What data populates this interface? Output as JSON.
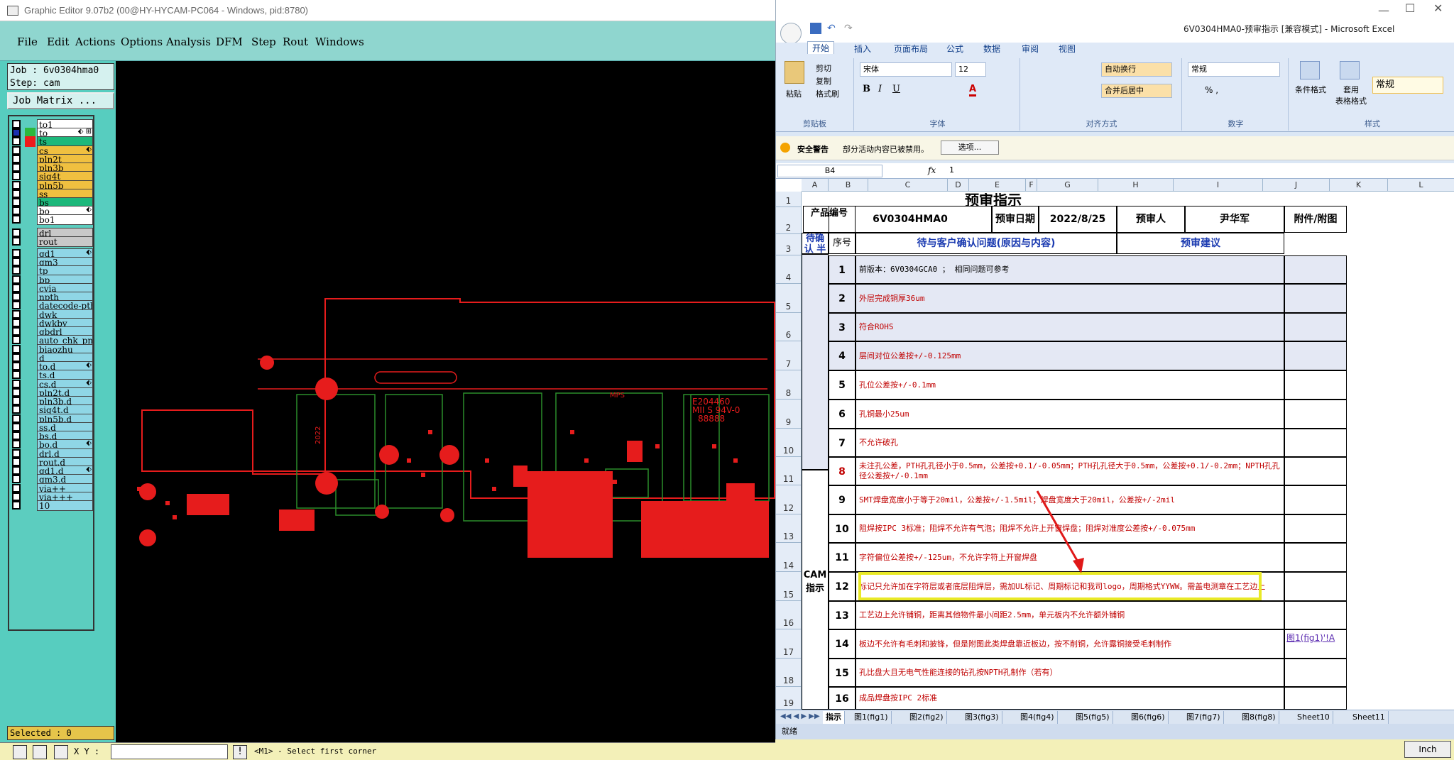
{
  "ge": {
    "title": "Graphic Editor 9.07b2 (00@HY-HYCAM-PC064 - Windows, pid:8780)",
    "menu": [
      "File",
      "Edit",
      "Actions",
      "Options",
      "Analysis",
      "DFM",
      "Step",
      "Rout",
      "Windows"
    ],
    "job": "Job : 6v0304hma0",
    "step": "Step: cam",
    "job_matrix": "Job Matrix ...",
    "layers": [
      {
        "name": "to1",
        "color": "#ffffff",
        "mark": "",
        "sel": "off"
      },
      {
        "name": "to",
        "color": "#ffffff",
        "mark": "⬖ ⊞",
        "sel": "on",
        "sw": "#2db83d"
      },
      {
        "name": "ts",
        "color": "#1db87b",
        "mark": "",
        "sel": "off",
        "sw": "#ee1c1c"
      },
      {
        "name": "cs",
        "color": "#f0c040",
        "mark": "⬖",
        "sel": "off"
      },
      {
        "name": "pln2t",
        "color": "#f0c040",
        "mark": "",
        "sel": "off"
      },
      {
        "name": "pln3b",
        "color": "#f0c040",
        "mark": "",
        "sel": "off"
      },
      {
        "name": "sig4t",
        "color": "#f0c040",
        "mark": "",
        "sel": "off"
      },
      {
        "name": "pln5b",
        "color": "#f0c040",
        "mark": "",
        "sel": "off"
      },
      {
        "name": "ss",
        "color": "#f0c040",
        "mark": "",
        "sel": "off"
      },
      {
        "name": "bs",
        "color": "#1db87b",
        "mark": "",
        "sel": "off"
      },
      {
        "name": "bo",
        "color": "#ffffff",
        "mark": "⬖",
        "sel": "off"
      },
      {
        "name": "bo1",
        "color": "#ffffff",
        "mark": "",
        "sel": "off"
      },
      {
        "name": "drl",
        "color": "#c8c8c8",
        "mark": "",
        "sel": "off"
      },
      {
        "name": "rout",
        "color": "#c8c8c8",
        "mark": "",
        "sel": "off"
      },
      {
        "name": "gd1",
        "color": "#8fd6e6",
        "mark": "⬖",
        "sel": "off"
      },
      {
        "name": "gm3",
        "color": "#8fd6e6",
        "mark": "",
        "sel": "off"
      },
      {
        "name": "tp",
        "color": "#8fd6e6",
        "mark": "",
        "sel": "off"
      },
      {
        "name": "bp",
        "color": "#8fd6e6",
        "mark": "",
        "sel": "off"
      },
      {
        "name": "cvia",
        "color": "#8fd6e6",
        "mark": "",
        "sel": "off"
      },
      {
        "name": "npth",
        "color": "#8fd6e6",
        "mark": "",
        "sel": "off"
      },
      {
        "name": "datecode-pth",
        "color": "#8fd6e6",
        "mark": "",
        "sel": "off"
      },
      {
        "name": "dwk",
        "color": "#8fd6e6",
        "mark": "",
        "sel": "off"
      },
      {
        "name": "dwkby",
        "color": "#8fd6e6",
        "mark": "",
        "sel": "off"
      },
      {
        "name": "gbdrl",
        "color": "#8fd6e6",
        "mark": "",
        "sel": "off"
      },
      {
        "name": "auto_chk_pn",
        "color": "#8fd6e6",
        "mark": "",
        "sel": "off"
      },
      {
        "name": "biaozhu",
        "color": "#8fd6e6",
        "mark": "",
        "sel": "off"
      },
      {
        "name": "d",
        "color": "#8fd6e6",
        "mark": "",
        "sel": "off"
      },
      {
        "name": "to.d",
        "color": "#8fd6e6",
        "mark": "⬖",
        "sel": "off"
      },
      {
        "name": "ts.d",
        "color": "#8fd6e6",
        "mark": "",
        "sel": "off"
      },
      {
        "name": "cs.d",
        "color": "#8fd6e6",
        "mark": "⬖",
        "sel": "off"
      },
      {
        "name": "pln2t.d",
        "color": "#8fd6e6",
        "mark": "",
        "sel": "off"
      },
      {
        "name": "pln3b.d",
        "color": "#8fd6e6",
        "mark": "",
        "sel": "off"
      },
      {
        "name": "sig4t.d",
        "color": "#8fd6e6",
        "mark": "",
        "sel": "off"
      },
      {
        "name": "pln5b.d",
        "color": "#8fd6e6",
        "mark": "",
        "sel": "off"
      },
      {
        "name": "ss.d",
        "color": "#8fd6e6",
        "mark": "",
        "sel": "off"
      },
      {
        "name": "bs.d",
        "color": "#8fd6e6",
        "mark": "",
        "sel": "off"
      },
      {
        "name": "bo.d",
        "color": "#8fd6e6",
        "mark": "⬖",
        "sel": "off"
      },
      {
        "name": "drl.d",
        "color": "#8fd6e6",
        "mark": "",
        "sel": "off"
      },
      {
        "name": "rout.d",
        "color": "#8fd6e6",
        "mark": "",
        "sel": "off"
      },
      {
        "name": "gd1.d",
        "color": "#8fd6e6",
        "mark": "⬖",
        "sel": "off"
      },
      {
        "name": "gm3.d",
        "color": "#8fd6e6",
        "mark": "",
        "sel": "off"
      },
      {
        "name": "via++",
        "color": "#8fd6e6",
        "mark": "",
        "sel": "off"
      },
      {
        "name": "via+++",
        "color": "#8fd6e6",
        "mark": "",
        "sel": "off"
      },
      {
        "name": "10",
        "color": "#8fd6e6",
        "mark": "",
        "sel": "off"
      }
    ],
    "selected": "Selected : 0",
    "xy_label": "X Y :",
    "status_msg": "<M1> - Select first corner",
    "units": "Inch",
    "board_text": [
      "E204460",
      "MII S 94V-0",
      "88888",
      "MPS",
      "2022"
    ]
  },
  "xl": {
    "title": "6V0304HMA0-预审指示  [兼容模式] - Microsoft Excel",
    "tabs": [
      "开始",
      "插入",
      "页面布局",
      "公式",
      "数据",
      "审阅",
      "视图"
    ],
    "clipboard": {
      "paste": "粘贴",
      "cut": "剪切",
      "copy": "复制",
      "format": "格式刷",
      "group": "剪贴板"
    },
    "font": {
      "name": "宋体",
      "size": "12",
      "group": "字体"
    },
    "align": {
      "wrap": "自动换行",
      "merge": "合并后居中",
      "group": "对齐方式"
    },
    "number": {
      "format": "常规",
      "group": "数字"
    },
    "styles": {
      "cond": "条件格式",
      "table": "套用\n表格格式",
      "normal_label": "常规",
      "group": "样式"
    },
    "security": {
      "label": "安全警告",
      "msg": "部分活动内容已被禁用。",
      "btn": "选项..."
    },
    "namebox": "B4",
    "fx": "fx",
    "formula": "1",
    "cols": [
      "A",
      "B",
      "C",
      "D",
      "E",
      "F",
      "G",
      "H",
      "I",
      "J",
      "K",
      "L"
    ],
    "sheet_title": "预审指示",
    "hdr": {
      "product": "产品编号",
      "code": "6V0304HMA0",
      "date_label": "预审日期",
      "date": "2022/8/25",
      "reviewer_label": "预审人",
      "reviewer": "尹华军",
      "attach": "附件/附图"
    },
    "hdr2": {
      "confirm": "待确认\n半检讨",
      "seq": "序号",
      "issue": "待与客户确认问题(原因与内容)",
      "advice": "预审建议"
    },
    "cam_label": "CAM\n指示",
    "rows": [
      {
        "n": "1",
        "t": "前版本：6V0304GCA0 ； 相同问题可参考",
        "red": false,
        "attach": ""
      },
      {
        "n": "2",
        "t": "外层完成铜厚36um",
        "red": true,
        "attach": ""
      },
      {
        "n": "3",
        "t": "符合ROHS",
        "red": true,
        "attach": ""
      },
      {
        "n": "4",
        "t": "层间对位公差按+/-0.125mm",
        "red": true,
        "attach": ""
      },
      {
        "n": "5",
        "t": "孔位公差按+/-0.1mm",
        "red": true,
        "attach": ""
      },
      {
        "n": "6",
        "t": "孔铜最小25um",
        "red": true,
        "attach": ""
      },
      {
        "n": "7",
        "t": "不允许破孔",
        "red": true,
        "attach": ""
      },
      {
        "n": "8",
        "t": "未注孔公差，PTH孔孔径小于0.5mm，公差按+0.1/-0.05mm；PTH孔孔径大于0.5mm，公差按+0.1/-0.2mm；NPTH孔孔径公差按+/-0.1mm",
        "red": true,
        "attach": ""
      },
      {
        "n": "9",
        "t": "SMT焊盘宽度小于等于20mil，公差按+/-1.5mil；焊盘宽度大于20mil，公差按+/-2mil",
        "red": true,
        "attach": ""
      },
      {
        "n": "10",
        "t": "阻焊按IPC 3标准；阻焊不允许有气泡；阻焊不允许上开窗焊盘；阻焊对准度公差按+/-0.075mm",
        "red": true,
        "attach": ""
      },
      {
        "n": "11",
        "t": "字符偏位公差按+/-125um，不允许字符上开窗焊盘",
        "red": true,
        "attach": ""
      },
      {
        "n": "12",
        "t": "标记只允许加在字符层或者底层阻焊层，需加UL标记、周期标记和我司logo，周期格式YYWW。需盖电测章在工艺边上",
        "red": true,
        "attach": ""
      },
      {
        "n": "13",
        "t": "工艺边上允许铺铜，距离其他物件最小间距2.5mm，单元板内不允许额外铺铜",
        "red": true,
        "attach": ""
      },
      {
        "n": "14",
        "t": "板边不允许有毛刺和披锋，但是附图此类焊盘靠近板边，按不削铜，允许露铜接受毛刺制作",
        "red": true,
        "attach": "图1(fig1)'!A"
      },
      {
        "n": "15",
        "t": "孔比盘大且无电气性能连接的钻孔按NPTH孔制作（若有）",
        "red": true,
        "attach": ""
      },
      {
        "n": "16",
        "t": "成品焊盘按IPC 2标准",
        "red": true,
        "attach": ""
      }
    ],
    "row_nums": [
      "1",
      "2",
      "3",
      "4",
      "5",
      "6",
      "7",
      "8",
      "9",
      "10",
      "11",
      "12",
      "13",
      "14",
      "15",
      "16",
      "17",
      "18",
      "19"
    ],
    "sheets": [
      "指示",
      "图1(fig1)",
      "图2(fig2)",
      "图3(fig3)",
      "图4(fig4)",
      "图5(fig5)",
      "图6(fig6)",
      "图7(fig7)",
      "图8(fig8)",
      "Sheet10",
      "Sheet11"
    ],
    "status": "就绪"
  }
}
